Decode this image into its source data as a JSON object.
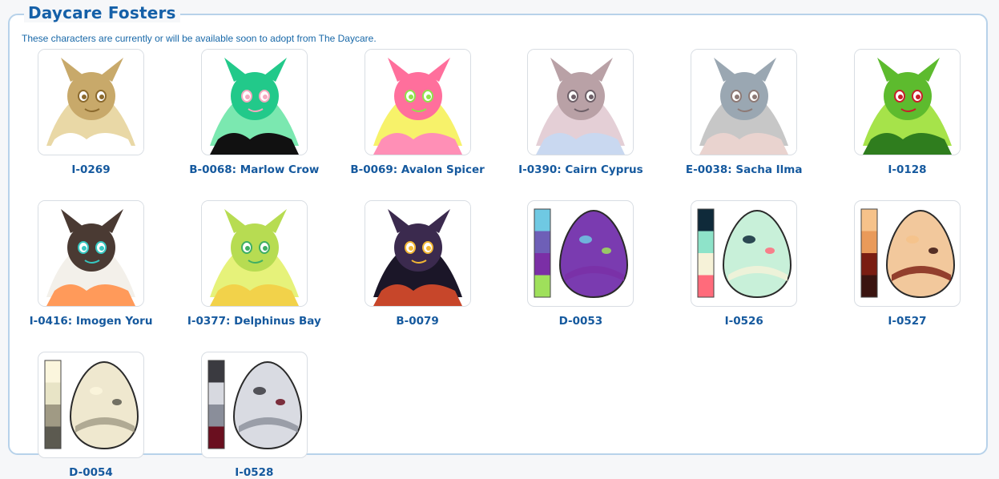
{
  "section": {
    "title": "Daycare Fosters",
    "subtitle": "These characters are currently or will be available soon to adopt from The Daycare."
  },
  "items": [
    {
      "label": "I-0269",
      "kind": "character",
      "colors": [
        "#c8a96a",
        "#e9d8a6",
        "#8b6a2e",
        "#ffffff"
      ]
    },
    {
      "label": "B-0068: Marlow Crow",
      "kind": "character",
      "colors": [
        "#22c98a",
        "#7be8b0",
        "#f5a9c0",
        "#111111"
      ]
    },
    {
      "label": "B-0069: Avalon Spicer",
      "kind": "character",
      "colors": [
        "#ff6f9c",
        "#f7f26a",
        "#8fe34a",
        "#ff8fb6"
      ]
    },
    {
      "label": "I-0390: Cairn Cyprus",
      "kind": "character",
      "colors": [
        "#b9a1a6",
        "#e4cfd6",
        "#6e6068",
        "#c9d8f0"
      ]
    },
    {
      "label": "E-0038: Sacha Ilma",
      "kind": "character",
      "colors": [
        "#9aa7b2",
        "#c7c7c7",
        "#8d7a76",
        "#e9d3cf"
      ]
    },
    {
      "label": "I-0128",
      "kind": "character",
      "colors": [
        "#5dbb2e",
        "#a6e34a",
        "#c81e2a",
        "#2f7d1e"
      ]
    },
    {
      "label": "I-0416: Imogen Yoru",
      "kind": "character",
      "colors": [
        "#4a3a33",
        "#f3f0ea",
        "#36c7c1",
        "#ff9a5a"
      ]
    },
    {
      "label": "I-0377: Delphinus Bay",
      "kind": "character",
      "colors": [
        "#b7dc52",
        "#e6f27a",
        "#3fae63",
        "#f2d24a"
      ]
    },
    {
      "label": "B-0079",
      "kind": "character",
      "colors": [
        "#3b2a4e",
        "#1b1628",
        "#f2b734",
        "#c7462a"
      ]
    },
    {
      "label": "D-0053",
      "kind": "egg",
      "colors": [
        "#6fc9e3",
        "#6e5fb7",
        "#7b2fa6",
        "#9fe05b"
      ],
      "egg": "#7a3bb0"
    },
    {
      "label": "I-0526",
      "kind": "egg",
      "colors": [
        "#0f2a3a",
        "#8ee3c9",
        "#f6f2d8",
        "#ff6b7b"
      ],
      "egg": "#c8f0d9"
    },
    {
      "label": "I-0527",
      "kind": "egg",
      "colors": [
        "#f6c28a",
        "#e99a5a",
        "#7a1d12",
        "#3a1410"
      ],
      "egg": "#f2c89c"
    },
    {
      "label": "D-0054",
      "kind": "egg",
      "colors": [
        "#fbf6dd",
        "#e8e4c6",
        "#a09a84",
        "#5c5a50"
      ],
      "egg": "#efe8cf"
    },
    {
      "label": "I-0528",
      "kind": "egg",
      "colors": [
        "#3a3a40",
        "#d7d9e0",
        "#8a8e9a",
        "#6a0f1f"
      ],
      "egg": "#d9dbe2"
    }
  ]
}
